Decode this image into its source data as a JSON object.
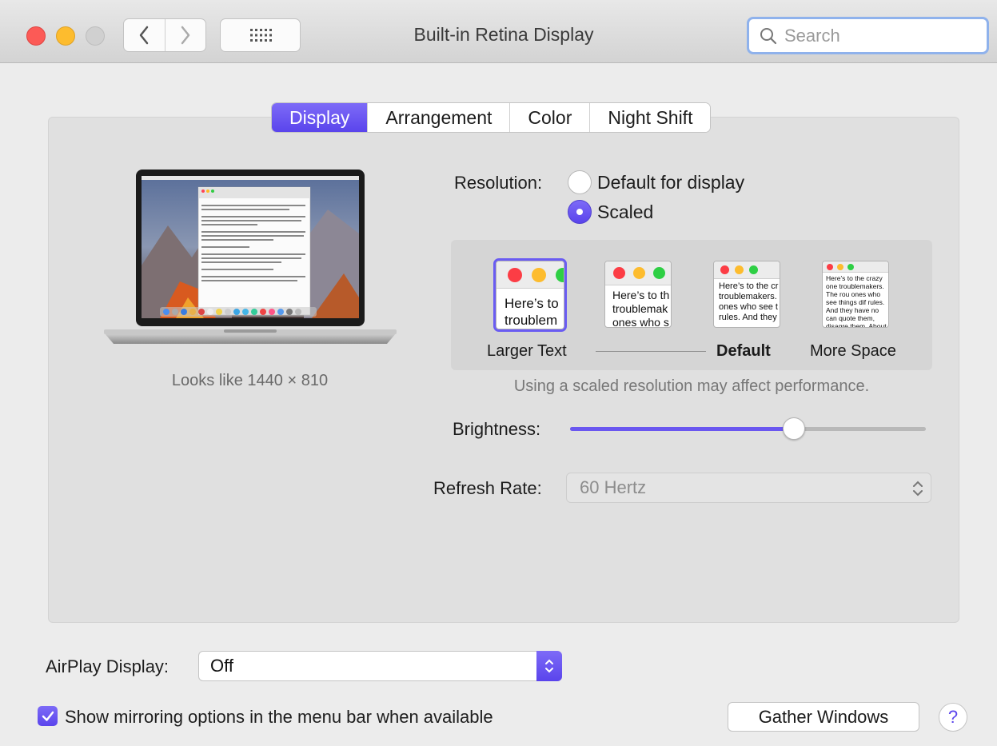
{
  "window": {
    "title": "Built-in Retina Display",
    "search_placeholder": "Search"
  },
  "tabs": [
    {
      "label": "Display",
      "active": true
    },
    {
      "label": "Arrangement",
      "active": false
    },
    {
      "label": "Color",
      "active": false
    },
    {
      "label": "Night Shift",
      "active": false
    }
  ],
  "display": {
    "looks_like": "Looks like 1440 × 810",
    "resolution_label": "Resolution:",
    "resolution_options": [
      {
        "label": "Default for display",
        "selected": false
      },
      {
        "label": "Scaled",
        "selected": true
      }
    ],
    "scale_options": [
      {
        "preview_text": "Here’s to troublem",
        "selected": true
      },
      {
        "preview_text": "Here’s to th troublemak ones who s",
        "selected": false
      },
      {
        "preview_text": "Here’s to the cr troublemakers. ones who see t rules. And they",
        "selected": false
      },
      {
        "preview_text": "Here’s to the crazy one troublemakers. The rou ones who see things dif rules. And they have no can quote them, disagre them. About the only th Because they change th",
        "selected": false
      }
    ],
    "scale_labels": {
      "left": "Larger Text",
      "middle": "Default",
      "right": "More Space"
    },
    "performance_note": "Using a scaled resolution may affect performance.",
    "brightness_label": "Brightness:",
    "brightness_level": 0.63,
    "refresh_label": "Refresh Rate:",
    "refresh_value": "60 Hertz"
  },
  "footer": {
    "airplay_label": "AirPlay Display:",
    "airplay_value": "Off",
    "mirroring_label": "Show mirroring options in the menu bar when available",
    "mirroring_checked": true,
    "gather_button": "Gather Windows",
    "help_symbol": "?"
  },
  "colors": {
    "accent": "#5a44ec",
    "close": "#fc5a56",
    "minimize": "#fdbc2e"
  }
}
